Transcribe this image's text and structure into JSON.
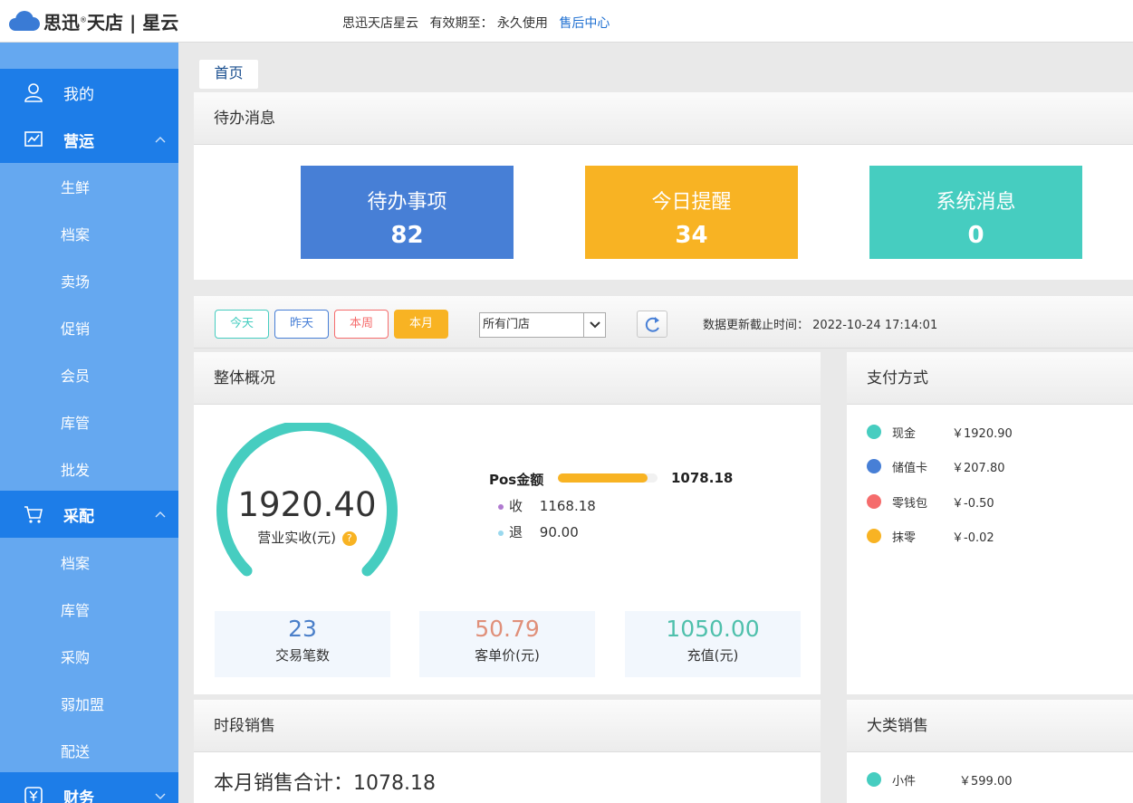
{
  "header": {
    "logo_text": "思迅",
    "logo_reg": "®",
    "logo_text2": "天店 | 星云",
    "store_name": "思迅天店星云",
    "expiry_label": "有效期至：",
    "expiry_value": "永久使用",
    "support_link": "售后中心"
  },
  "sidebar": {
    "my": "我的",
    "operations": "营运",
    "ops_items": [
      "生鲜",
      "档案",
      "卖场",
      "促销",
      "会员",
      "库管",
      "批发"
    ],
    "procurement": "采配",
    "proc_items": [
      "档案",
      "库管",
      "采购",
      "弱加盟",
      "配送"
    ],
    "finance": "财务"
  },
  "tabs": {
    "home": "首页"
  },
  "pending": {
    "title": "待办消息",
    "cards": [
      {
        "label": "待办事项",
        "value": "82",
        "color": "#477fd6"
      },
      {
        "label": "今日提醒",
        "value": "34",
        "color": "#f8b323"
      },
      {
        "label": "系统消息",
        "value": "0",
        "color": "#46cdc0"
      }
    ]
  },
  "filters": {
    "today": "今天",
    "yesterday": "昨天",
    "this_week": "本周",
    "this_month": "本月",
    "store_select": "所有门店",
    "update_label": "数据更新截止时间：",
    "update_time": "2022-10-24 17:14:01"
  },
  "overview": {
    "title": "整体概况",
    "gauge_value": "1920.40",
    "gauge_label": "营业实收(元)",
    "help": "?",
    "pos_label": "Pos金额",
    "pos_value": "1078.18",
    "pos_fill": 0.9,
    "income_label": "收",
    "income_value": "1168.18",
    "refund_label": "退",
    "refund_value": "90.00",
    "stats": [
      {
        "value": "23",
        "label": "交易笔数",
        "color": "#4a7fc9"
      },
      {
        "value": "50.79",
        "label": "客单价(元)",
        "color": "#e0907a"
      },
      {
        "value": "1050.00",
        "label": "充值(元)",
        "color": "#4fc0ac"
      }
    ]
  },
  "payment": {
    "title": "支付方式",
    "items": [
      {
        "label": "现金",
        "value": "￥1920.90",
        "color": "#46cdc0"
      },
      {
        "label": "储值卡",
        "value": "￥207.80",
        "color": "#477fd6"
      },
      {
        "label": "零钱包",
        "value": "￥-0.50",
        "color": "#f56c6c"
      },
      {
        "label": "抹零",
        "value": "￥-0.02",
        "color": "#f8b323"
      }
    ]
  },
  "period_sales": {
    "title": "时段销售",
    "total_label": "本月销售合计：",
    "total_value": "1078.18"
  },
  "category_sales": {
    "title": "大类销售",
    "items": [
      {
        "label": "小件",
        "value": "￥599.00",
        "color": "#46cdc0"
      }
    ]
  }
}
